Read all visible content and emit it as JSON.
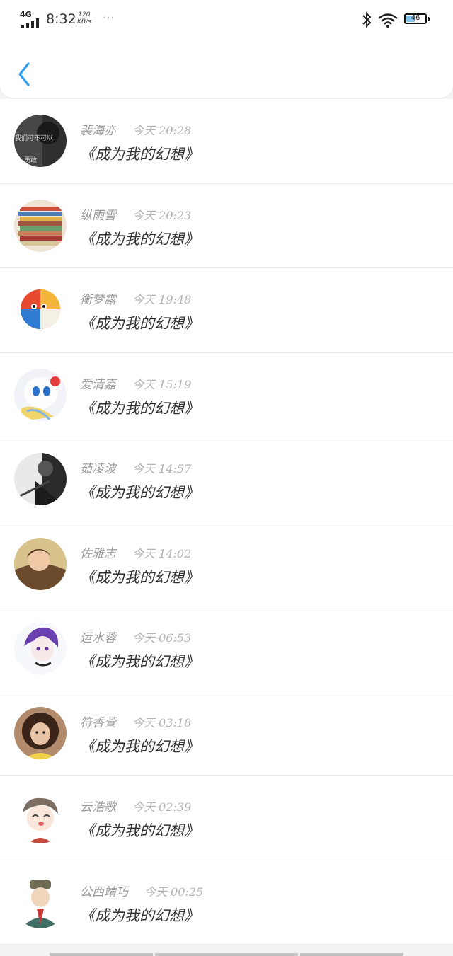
{
  "status_bar": {
    "network": "4G",
    "time": "8:32",
    "speed_value": "120",
    "speed_unit": "KB/s",
    "more": "···",
    "battery": "46",
    "battery_level": 0.46
  },
  "messages": [
    {
      "name": "裴海亦",
      "time": "今天 20:28",
      "title": "《成为我的幻想》",
      "avatar": "photo-dark",
      "avatar_caption": "我们可不可以",
      "avatar_caption2": "勇敢"
    },
    {
      "name": "纵雨雪",
      "time": "今天 20:23",
      "title": "《成为我的幻想》",
      "avatar": "fabric-stack"
    },
    {
      "name": "衡梦露",
      "time": "今天 19:48",
      "title": "《成为我的幻想》",
      "avatar": "beach-ball"
    },
    {
      "name": "爱清嘉",
      "time": "今天 15:19",
      "title": "《成为我的幻想》",
      "avatar": "anime-white"
    },
    {
      "name": "茹凌波",
      "time": "今天 14:57",
      "title": "《成为我的幻想》",
      "avatar": "guitar-bw"
    },
    {
      "name": "佐雅志",
      "time": "今天 14:02",
      "title": "《成为我的幻想》",
      "avatar": "fur-collar"
    },
    {
      "name": "运水蓉",
      "time": "今天 06:53",
      "title": "《成为我的幻想》",
      "avatar": "anime-purple"
    },
    {
      "name": "符香萱",
      "time": "今天 03:18",
      "title": "《成为我的幻想》",
      "avatar": "girl-curly"
    },
    {
      "name": "云浩歌",
      "time": "今天 02:39",
      "title": "《成为我的幻想》",
      "avatar": "chibi-boy"
    },
    {
      "name": "公西靖巧",
      "time": "今天 00:25",
      "title": "《成为我的幻想》",
      "avatar": "cartoon-man"
    }
  ],
  "colors": {
    "accent": "#2b9df3",
    "name_text": "#9a9a9a",
    "time_text": "#b3b3b3"
  }
}
